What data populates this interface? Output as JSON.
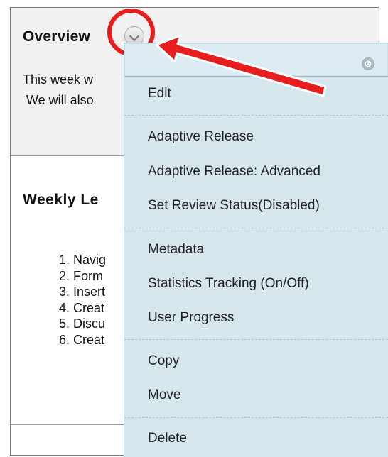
{
  "overview": {
    "title": "Overview",
    "line1": "This week w",
    "line2": " We will also"
  },
  "weekly": {
    "title": "Weekly Le",
    "items": [
      "1. Navig",
      "2. Form",
      "3. Insert",
      "4. Creat",
      "5. Discu",
      "6. Creat"
    ]
  },
  "menu": {
    "close_symbol": "⊗",
    "items": {
      "edit": "Edit",
      "adaptive_release": "Adaptive Release",
      "adaptive_release_advanced": "Adaptive Release: Advanced",
      "set_review_status": "Set Review Status(Disabled)",
      "metadata": "Metadata",
      "statistics_tracking": "Statistics Tracking (On/Off)",
      "user_progress": "User Progress",
      "copy": "Copy",
      "move": "Move",
      "delete": "Delete"
    }
  },
  "colors": {
    "highlight": "#e81e1e",
    "menu_bg": "#d5e7ed"
  }
}
